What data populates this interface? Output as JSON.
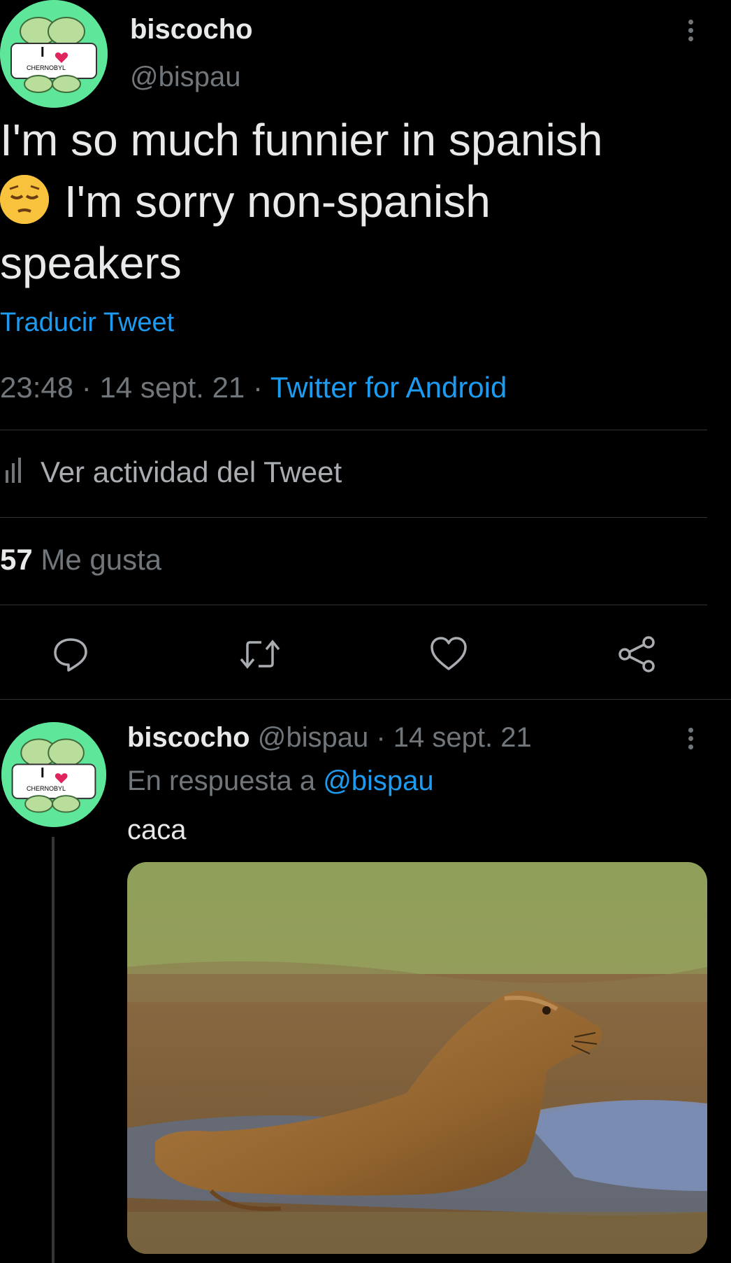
{
  "main_tweet": {
    "display_name": "biscocho",
    "handle": "@bispau",
    "text_line1": "I'm so much funnier in spanish",
    "emoji": "pensive-face-emoji",
    "text_line2": "I'm sorry non-spanish",
    "text_line3": "speakers",
    "translate_label": "Traducir Tweet",
    "time": "23:48",
    "separator": "·",
    "date": "14 sept. 21",
    "source": "Twitter for Android",
    "activity_label": "Ver actividad del Tweet",
    "likes_count": "57",
    "likes_label": "Me gusta",
    "avatar_text_top": "I",
    "avatar_text_bottom": "CHERNOBYL"
  },
  "actions": [
    "reply-icon",
    "retweet-icon",
    "like-icon",
    "share-icon"
  ],
  "reply_tweet": {
    "display_name": "biscocho",
    "handle": "@bispau",
    "separator": "·",
    "date": "14 sept. 21",
    "reply_prefix": "En respuesta a",
    "reply_to": "@bispau",
    "text": "caca",
    "avatar_text_top": "I",
    "avatar_text_bottom": "CHERNOBYL"
  },
  "colors": {
    "background": "#000000",
    "accent": "#1d9bf0",
    "secondary_text": "#71767b",
    "avatar_bg": "#5ee69a",
    "heart": "#e0245e"
  }
}
